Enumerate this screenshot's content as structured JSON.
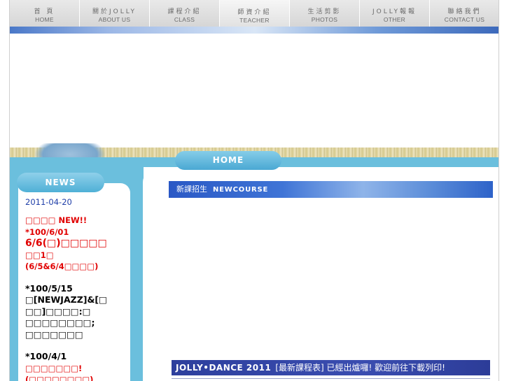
{
  "nav": {
    "items": [
      {
        "zh": "首 頁",
        "en": "HOME"
      },
      {
        "zh": "關於JOLLY",
        "en": "ABOUT US"
      },
      {
        "zh": "課程介紹",
        "en": "CLASS"
      },
      {
        "zh": "師資介紹",
        "en": "TEACHER"
      },
      {
        "zh": "生活剪影",
        "en": "PHOTOS"
      },
      {
        "zh": "JOLLY報報",
        "en": "OTHER"
      },
      {
        "zh": "聯絡我們",
        "en": "CONTACT US"
      }
    ]
  },
  "home_label": "HOME",
  "news": {
    "label": "NEWS",
    "date": "2011-04-20",
    "line1": "□□□□ NEW!!",
    "line2": "*100/6/01",
    "line3": "6/6(□)□□□□□",
    "line4": "□□1□",
    "line5": "(6/5&6/4□□□□)",
    "line6": "*100/5/15",
    "line7": "□[NEWJAZZ]&[□",
    "line8": "□□]□□□□:□",
    "line9": "□□□□□□□□;",
    "line10": "□□□□□□□",
    "line11": "*100/4/1",
    "line12": "□□□□□□□!",
    "line13": "(□□□□□□□□)"
  },
  "section": {
    "zh": "新課招生",
    "en": "NEWCOURSE"
  },
  "banner": {
    "brand": "JOLLY•DANCE 2011",
    "text": "[最新課程表] 已經出爐囉! 歡迎前往下載列印!"
  }
}
